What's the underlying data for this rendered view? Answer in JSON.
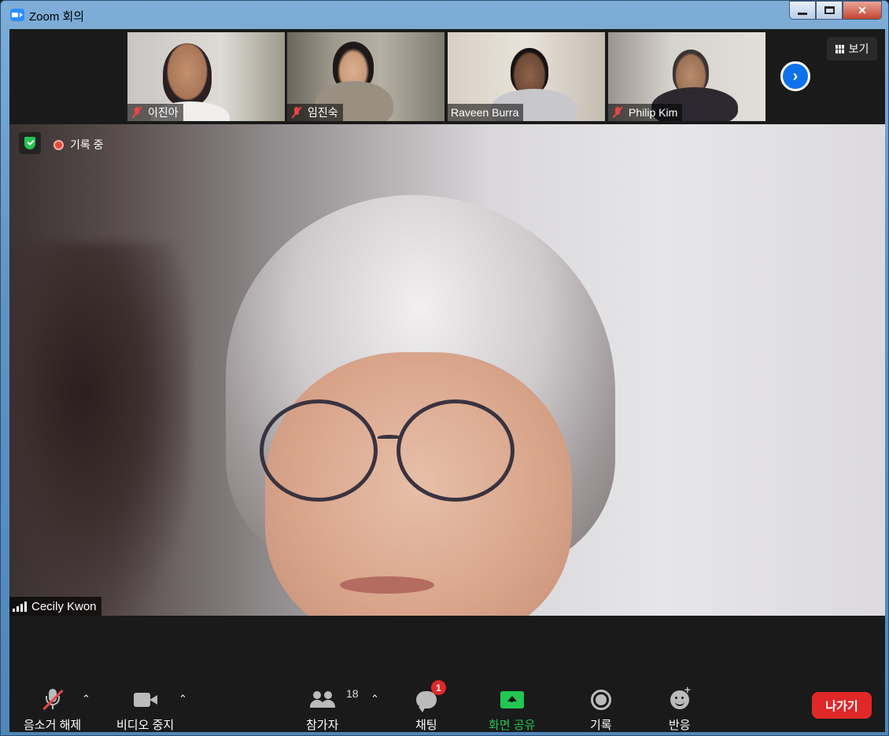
{
  "window": {
    "title": "Zoom 회의"
  },
  "thumbnails": [
    {
      "name": "이진아",
      "muted": true
    },
    {
      "name": "임진숙",
      "muted": true
    },
    {
      "name": "Raveen Burra",
      "muted": false
    },
    {
      "name": "Philip Kim",
      "muted": true
    }
  ],
  "view_button": {
    "label": "보기"
  },
  "recording": {
    "label": "기록 중"
  },
  "main_speaker": {
    "name": "Cecily Kwon"
  },
  "toolbar": {
    "unmute_label": "음소거 해제",
    "stop_video_label": "비디오 중지",
    "participants_label": "참가자",
    "participants_count": "18",
    "chat_label": "채팅",
    "chat_badge": "1",
    "share_label": "화면 공유",
    "record_label": "기록",
    "reactions_label": "반응",
    "leave_label": "나가기"
  },
  "colors": {
    "accent_blue": "#0e72ed",
    "share_green": "#23c552",
    "leave_red": "#e02828"
  }
}
